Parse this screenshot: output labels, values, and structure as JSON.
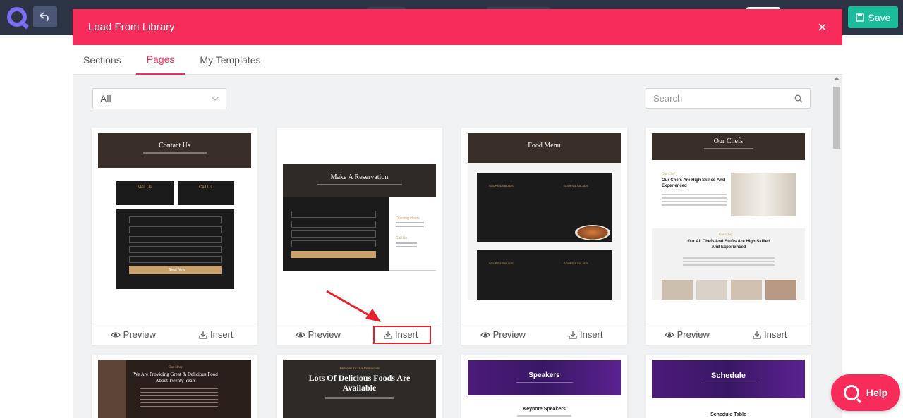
{
  "editor": {
    "save_label": "Save"
  },
  "modal": {
    "title": "Load From Library",
    "close_symbol": "×",
    "tabs": [
      {
        "label": "Sections",
        "active": false
      },
      {
        "label": "Pages",
        "active": true
      },
      {
        "label": "My Templates",
        "active": false
      }
    ],
    "filter": {
      "selected": "All"
    },
    "search": {
      "placeholder": "Search"
    }
  },
  "card_actions": {
    "preview": "Preview",
    "insert": "Insert"
  },
  "templates": [
    {
      "title": "Contact Us",
      "blocks": [
        "Mail Us",
        "Call Us"
      ],
      "button": "Send Now"
    },
    {
      "title": "Make A Reservation",
      "side": [
        "Opening Hours",
        "Call Us"
      ]
    },
    {
      "title": "Food Menu",
      "sections": [
        "SOUPS & SALADS",
        "SOUPS & SALADS",
        "SOUPS & SALADS",
        "SOUPS & SALADS"
      ]
    },
    {
      "title": "Our Chefs",
      "kicker": "Our Chef",
      "heading_1": "Our Chefs Are High Skilled And Experienced",
      "heading_2": "Our All Chefs And Stuffs Are High Skilled And Experienced"
    },
    {
      "kicker": "Our Story",
      "title": "We Are Providing Great & Delicious Food About Twenty Years"
    },
    {
      "kicker": "Welcome To Our Restaurant",
      "title": "Lots Of Delicious Foods Are Available"
    },
    {
      "title": "Speakers",
      "subtitle": "Keynote Speakers"
    },
    {
      "title": "Schedule",
      "subtitle": "Schedule Table"
    }
  ],
  "help": {
    "label": "Help"
  },
  "colors": {
    "accent": "#f82c5a",
    "save": "#1abc9c",
    "topbar": "#2b3345",
    "highlight": "#e8202c"
  }
}
